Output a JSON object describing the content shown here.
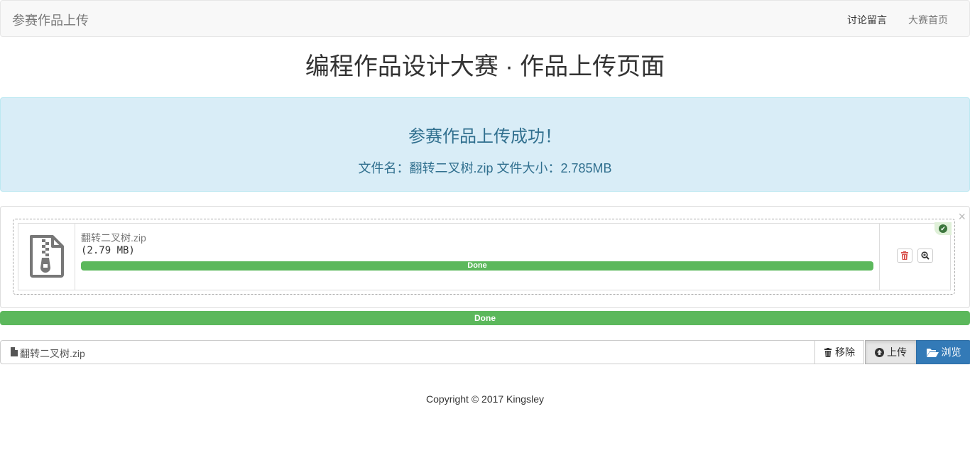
{
  "navbar": {
    "brand": "参赛作品上传",
    "links": [
      {
        "label": "讨论留言"
      },
      {
        "label": "大赛首页"
      }
    ]
  },
  "page_title": "编程作品设计大赛 · 作品上传页面",
  "alert": {
    "title": "参赛作品上传成功！",
    "info": "文件名：翻转二叉树.zip 文件大小：2.785MB"
  },
  "preview": {
    "close_symbol": "×",
    "file": {
      "name": "翻转二叉树.zip",
      "size": "(2.79 MB)",
      "progress_label": "Done",
      "progress_percent": 100
    }
  },
  "overall_progress": {
    "label": "Done",
    "percent": 100
  },
  "input": {
    "caption": "翻转二叉树.zip",
    "remove_label": "移除",
    "upload_label": "上传",
    "browse_label": "浏览"
  },
  "footer": "Copyright © 2017 Kingsley",
  "colors": {
    "success": "#5cb85c",
    "primary": "#337ab7",
    "info_bg": "#d9edf7",
    "info_text": "#31708f",
    "danger": "#d9534f"
  },
  "icons": [
    "zip-file-icon",
    "check-circle-icon",
    "trash-icon",
    "zoom-icon",
    "file-icon",
    "upload-icon",
    "folder-open-icon"
  ]
}
